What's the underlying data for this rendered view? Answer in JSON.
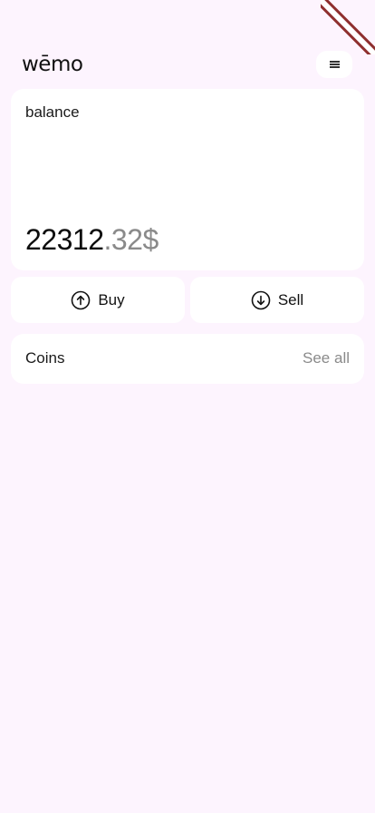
{
  "app": {
    "logo_text": "wēmo"
  },
  "header": {
    "menu_icon": "hamburger-menu-icon"
  },
  "balance": {
    "label": "balance",
    "amount_integer": "22312",
    "amount_decimal": ".32$"
  },
  "actions": {
    "buy_label": "Buy",
    "buy_icon": "arrow-up-circle-icon",
    "sell_label": "Sell",
    "sell_icon": "arrow-down-circle-icon"
  },
  "coins": {
    "title": "Coins",
    "see_all_label": "See all"
  },
  "colors": {
    "background": "#fdf4fe",
    "card": "#ffffff",
    "muted_text": "#8a8a8a",
    "debug_banner": "#8f2f2f"
  }
}
